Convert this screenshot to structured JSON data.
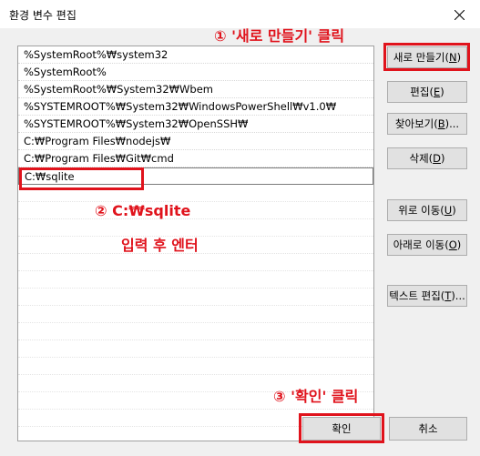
{
  "window": {
    "title": "환경 변수 편집",
    "close_icon": "close-icon"
  },
  "path_entries": [
    "%SystemRoot%₩system32",
    "%SystemRoot%",
    "%SystemRoot%₩System32₩Wbem",
    "%SYSTEMROOT%₩System32₩WindowsPowerShell₩v1.0₩",
    "%SYSTEMROOT%₩System32₩OpenSSH₩",
    "C:₩Program Files₩nodejs₩",
    "C:₩Program Files₩Git₩cmd",
    "C:₩sqlite"
  ],
  "buttons": {
    "new": {
      "label": "새로 만들기(",
      "key": "N",
      "end": ")"
    },
    "edit": {
      "label": "편집(",
      "key": "E",
      "end": ")"
    },
    "browse": {
      "label": "찾아보기(",
      "key": "B",
      "end": ")..."
    },
    "delete": {
      "label": "삭제(",
      "key": "D",
      "end": ")"
    },
    "move_up": {
      "label": "위로 이동(",
      "key": "U",
      "end": ")"
    },
    "move_down": {
      "label": "아래로 이동(",
      "key": "O",
      "end": ")"
    },
    "edit_text": {
      "label": "텍스트 편집(",
      "key": "T",
      "end": ")..."
    },
    "ok": "확인",
    "cancel": "취소"
  },
  "annotations": {
    "step1": "① '새로 만들기' 클릭",
    "step2_line1": "② C:₩sqlite",
    "step2_line2": "입력 후 엔터",
    "step3": "③ '확인' 클릭",
    "color": "#e0131c"
  }
}
